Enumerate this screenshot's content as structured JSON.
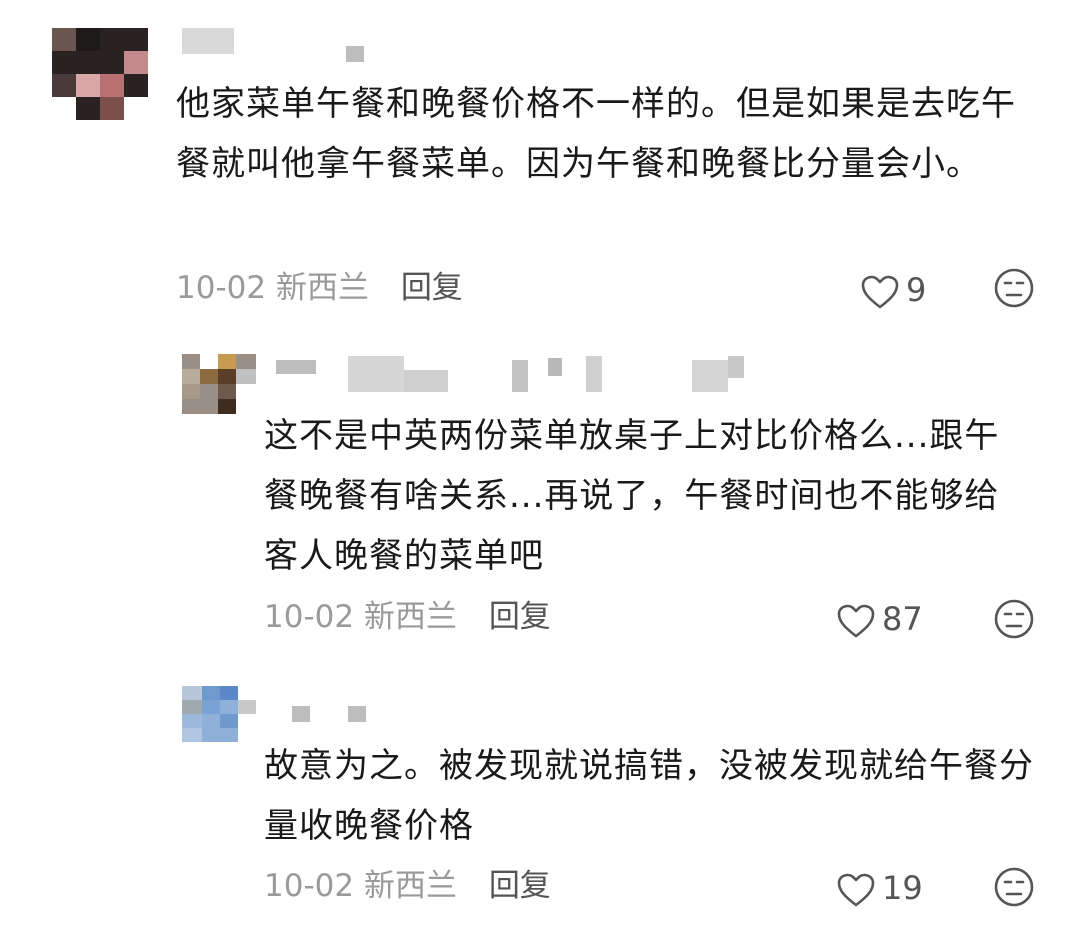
{
  "comments": [
    {
      "text": "他家菜单午餐和晚餐价格不一样的。但是如果是去吃午餐就叫他拿午餐菜单。因为午餐和晚餐比分量会小。",
      "date": "10-02",
      "location": "新西兰",
      "reply_label": "回复",
      "likes": "9"
    },
    {
      "text": "这不是中英两份菜单放桌子上对比价格么...跟午餐晚餐有啥关系...再说了，午餐时间也不能够给客人晚餐的菜单吧",
      "date": "10-02",
      "location": "新西兰",
      "reply_label": "回复",
      "likes": "87"
    },
    {
      "text": "故意为之。被发现就说搞错，没被发现就给午餐分量收晚餐价格",
      "date": "10-02",
      "location": "新西兰",
      "reply_label": "回复",
      "likes": "19"
    }
  ],
  "icons": {
    "like": "heart-outline-icon",
    "dislike": "dislike-face-icon"
  },
  "colors": {
    "text": "#1a1a1a",
    "meta": "#9a9a9a",
    "action": "#555555"
  }
}
